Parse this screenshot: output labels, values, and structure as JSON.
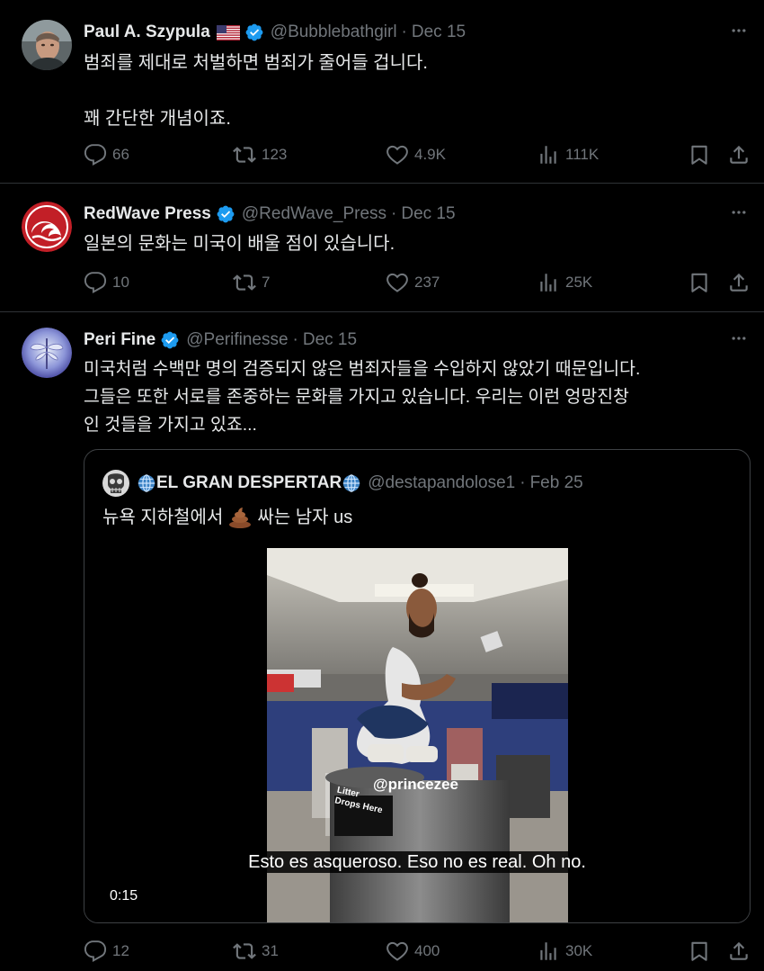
{
  "tweets": [
    {
      "name": "Paul A. Szypula",
      "handle": "@Bubblebathgirl",
      "date": "Dec 15",
      "text": "범죄를 제대로 처벌하면 범죄가 줄어들 겁니다.\n\n꽤 간단한 개념이죠.",
      "replies": "66",
      "reposts": "123",
      "likes": "4.9K",
      "views": "111K"
    },
    {
      "name": "RedWave Press",
      "handle": "@RedWave_Press",
      "date": "Dec 15",
      "text": "일본의 문화는 미국이 배울 점이 있습니다.",
      "replies": "10",
      "reposts": "7",
      "likes": "237",
      "views": "25K"
    },
    {
      "name": "Peri Fine",
      "handle": "@Perifinesse",
      "date": "Dec 15",
      "text": "미국처럼 수백만 명의 검증되지 않은 범죄자들을 수입하지 않았기 때문입니다.\n그들은 또한 서로를 존중하는 문화를 가지고 있습니다. 우리는 이런 엉망진창\n인 것들을 가지고 있죠...",
      "replies": "12",
      "reposts": "31",
      "likes": "400",
      "views": "30K"
    }
  ],
  "quote": {
    "name": "EL GRAN DESPERTAR",
    "handle": "@destapandolose1",
    "date": "Feb 25",
    "text_before": "뉴욕 지하철에서",
    "text_after": "싸는 남자 us",
    "video_watermark": "@princezee",
    "bin_sign": "Litter\nDrops Here",
    "caption": "Esto es asqueroso. Eso no es real. Oh no.",
    "duration": "0:15"
  },
  "colors": {
    "background": "#000000",
    "verified": "#1d9bf0",
    "muted": "#71767b",
    "text": "#e7e9ea"
  },
  "icons": [
    "more-icon",
    "reply-icon",
    "repost-icon",
    "like-icon",
    "views-icon",
    "bookmark-icon",
    "share-icon",
    "verified-badge-icon",
    "us-flag-icon",
    "globe-icon",
    "poop-emoji-icon"
  ]
}
